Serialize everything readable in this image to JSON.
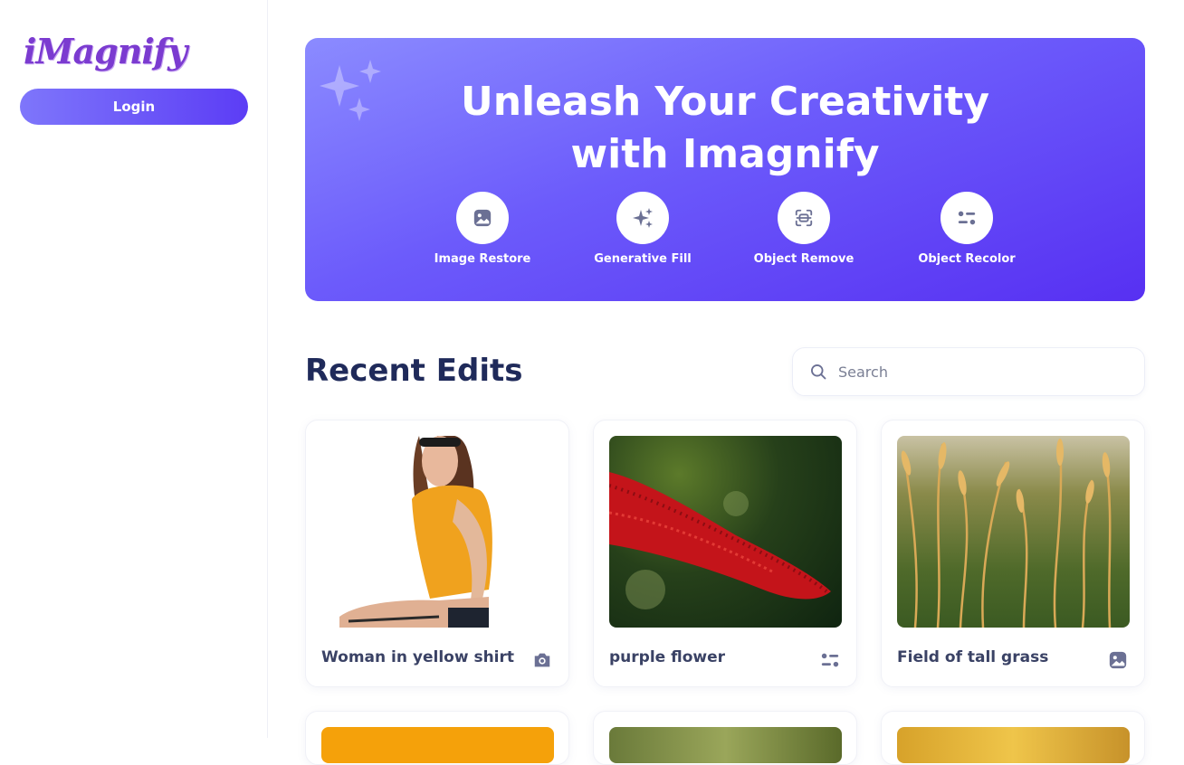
{
  "sidebar": {
    "logo": "iMagnify",
    "login_label": "Login"
  },
  "banner": {
    "title_line1": "Unleash Your Creativity",
    "title_line2": "with Imagnify",
    "tools": [
      {
        "label": "Image Restore",
        "icon": "image-icon"
      },
      {
        "label": "Generative Fill",
        "icon": "sparkles-icon"
      },
      {
        "label": "Object Remove",
        "icon": "scan-icon"
      },
      {
        "label": "Object Recolor",
        "icon": "filter-icon"
      }
    ]
  },
  "recent": {
    "title": "Recent Edits",
    "search_placeholder": "Search",
    "cards": [
      {
        "caption": "Woman in yellow shirt",
        "icon": "camera-icon"
      },
      {
        "caption": "purple flower",
        "icon": "filter-icon"
      },
      {
        "caption": "Field of tall grass",
        "icon": "image-icon"
      }
    ]
  },
  "colors": {
    "accent": "#5c3df5",
    "banner_start": "#8b8bff",
    "banner_end": "#5730f2",
    "heading": "#1f2a5a"
  }
}
